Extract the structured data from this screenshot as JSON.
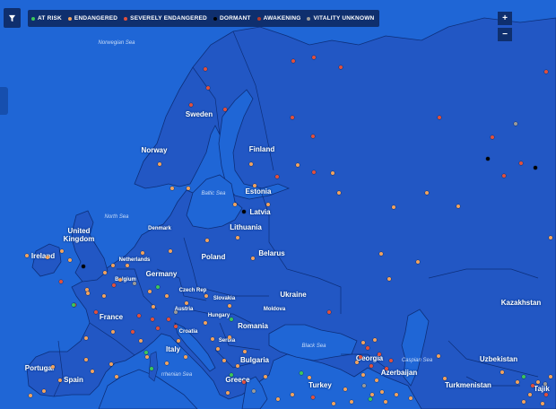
{
  "legend": {
    "items": [
      {
        "label": "AT RISK",
        "color": "#3cc75a"
      },
      {
        "label": "ENDANGERED",
        "color": "#f2a35e"
      },
      {
        "label": "SEVERELY ENDANGERED",
        "color": "#e2503c"
      },
      {
        "label": "DORMANT",
        "color": "#000000"
      },
      {
        "label": "AWAKENING",
        "color": "#b23a2b"
      },
      {
        "label": "VITALITY UNKNOWN",
        "color": "#9a9a9a"
      }
    ]
  },
  "controls": {
    "zoom_in": "+",
    "zoom_out": "−",
    "filter_icon": "filter-icon"
  },
  "map_colors": {
    "water": "#1f66d6",
    "land": "#2257c4",
    "border": "#0d2f7a"
  },
  "countries": {
    "sweden": "Sweden",
    "norway": "Norway",
    "finland": "Finland",
    "estonia": "Estonia",
    "latvia": "Latvia",
    "lithuania": "Lithuania",
    "denmark": "Denmark",
    "united_kingdom_1": "United",
    "united_kingdom_2": "Kingdom",
    "ireland": "Ireland",
    "netherlands": "Netherlands",
    "belgium": "Belgium",
    "germany": "Germany",
    "poland": "Poland",
    "belarus": "Belarus",
    "czech": "Czech Rep",
    "slovakia": "Slovakia",
    "austria": "Austria",
    "hungary": "Hungary",
    "ukraine": "Ukraine",
    "moldova": "Moldova",
    "romania": "Romania",
    "france": "France",
    "croatia": "Croatia",
    "serbia": "Serbia",
    "italy": "Italy",
    "bulgaria": "Bulgaria",
    "portugal": "Portugal",
    "spain": "Spain",
    "greece": "Greece",
    "turkey": "Turkey",
    "georgia": "Georgia",
    "azerbaijan": "Azerbaijan",
    "kazakhstan": "Kazakhstan",
    "uzbekistan": "Uzbekistan",
    "turkmenistan": "Turkmenistan",
    "tajikistan": "Tajik"
  },
  "seas": {
    "norwegian": "Norwegian Sea",
    "north": "North Sea",
    "baltic": "Baltic Sea",
    "black": "Black Sea",
    "caspian": "Caspian Sea",
    "tyrrhenian": "rrhenian Sea"
  }
}
